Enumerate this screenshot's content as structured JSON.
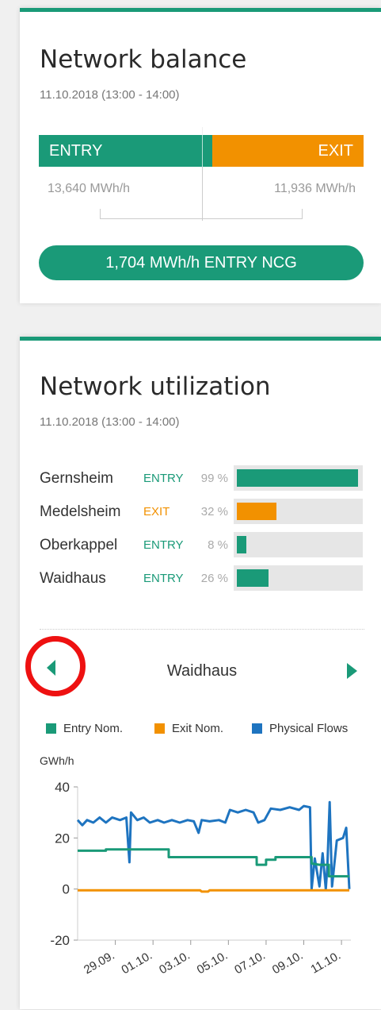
{
  "balance": {
    "title": "Network balance",
    "date": "11.10.2018 (13:00 - 14:00)",
    "entry_label": "ENTRY",
    "exit_label": "EXIT",
    "entry_value": "13,640 MWh/h",
    "exit_value": "11,936 MWh/h",
    "net_label": "1,704 MWh/h ENTRY NCG",
    "colors": {
      "entry": "#1a9a78",
      "exit": "#f29100"
    }
  },
  "utilization": {
    "title": "Network utilization",
    "date": "11.10.2018 (13:00 - 14:00)",
    "rows": [
      {
        "name": "Gernsheim",
        "direction": "ENTRY",
        "percent": "99 %",
        "value": 99
      },
      {
        "name": "Medelsheim",
        "direction": "EXIT",
        "percent": "32 %",
        "value": 32
      },
      {
        "name": "Oberkappel",
        "direction": "ENTRY",
        "percent": "8 %",
        "value": 8
      },
      {
        "name": "Waidhaus",
        "direction": "ENTRY",
        "percent": "26 %",
        "value": 26
      }
    ],
    "nav": {
      "title": "Waidhaus",
      "prev_icon": "triangle-left-icon",
      "next_icon": "triangle-right-icon"
    }
  },
  "legend": {
    "entry": "Entry Nom.",
    "exit": "Exit Nom.",
    "physical": "Physical Flows"
  },
  "chart_data": {
    "type": "line",
    "ylabel": "GWh/h",
    "ylim": [
      -20,
      40
    ],
    "yticks": [
      -20,
      0,
      20,
      40
    ],
    "x_range": [
      "2018-09-27",
      "2018-10-11"
    ],
    "xtick_labels": [
      "29.09.",
      "01.10.",
      "03.10.",
      "05.10.",
      "07.10.",
      "09.10.",
      "11.10."
    ],
    "xtick_dates": [
      "2018-09-29",
      "2018-10-01",
      "2018-10-03",
      "2018-10-05",
      "2018-10-07",
      "2018-10-09",
      "2018-10-11"
    ],
    "series": [
      {
        "name": "Physical Flows",
        "color": "#1e74c0",
        "points": [
          [
            "2018-09-27T00:00",
            27
          ],
          [
            "2018-09-27T06:00",
            25
          ],
          [
            "2018-09-27T12:00",
            27
          ],
          [
            "2018-09-27T20:00",
            26
          ],
          [
            "2018-09-28T04:00",
            28
          ],
          [
            "2018-09-28T12:00",
            26
          ],
          [
            "2018-09-28T20:00",
            28
          ],
          [
            "2018-09-29T06:00",
            27
          ],
          [
            "2018-09-29T14:00",
            28
          ],
          [
            "2018-09-29T18:00",
            10.5
          ],
          [
            "2018-09-29T20:00",
            30
          ],
          [
            "2018-09-30T04:00",
            27
          ],
          [
            "2018-09-30T12:00",
            28
          ],
          [
            "2018-09-30T20:00",
            26
          ],
          [
            "2018-10-01T06:00",
            27
          ],
          [
            "2018-10-01T14:00",
            26
          ],
          [
            "2018-10-02T00:00",
            27
          ],
          [
            "2018-10-02T10:00",
            26
          ],
          [
            "2018-10-02T20:00",
            27
          ],
          [
            "2018-10-03T04:00",
            26.5
          ],
          [
            "2018-10-03T10:00",
            22
          ],
          [
            "2018-10-03T14:00",
            27
          ],
          [
            "2018-10-04T00:00",
            26.5
          ],
          [
            "2018-10-04T12:00",
            27
          ],
          [
            "2018-10-04T20:00",
            26
          ],
          [
            "2018-10-05T02:00",
            31
          ],
          [
            "2018-10-05T12:00",
            30
          ],
          [
            "2018-10-05T22:00",
            31
          ],
          [
            "2018-10-06T08:00",
            30
          ],
          [
            "2018-10-06T14:00",
            26
          ],
          [
            "2018-10-06T22:00",
            27
          ],
          [
            "2018-10-07T06:00",
            31.5
          ],
          [
            "2018-10-07T18:00",
            31
          ],
          [
            "2018-10-08T06:00",
            32
          ],
          [
            "2018-10-08T18:00",
            31
          ],
          [
            "2018-10-09T00:00",
            32.5
          ],
          [
            "2018-10-09T08:00",
            32
          ],
          [
            "2018-10-09T10:00",
            0
          ],
          [
            "2018-10-09T14:00",
            12
          ],
          [
            "2018-10-09T20:00",
            1
          ],
          [
            "2018-10-10T00:00",
            14
          ],
          [
            "2018-10-10T04:00",
            0
          ],
          [
            "2018-10-10T06:00",
            9
          ],
          [
            "2018-10-10T09:00",
            34
          ],
          [
            "2018-10-10T12:00",
            1
          ],
          [
            "2018-10-10T18:00",
            19
          ],
          [
            "2018-10-11T02:00",
            20
          ],
          [
            "2018-10-11T06:00",
            24
          ],
          [
            "2018-10-11T10:00",
            0
          ]
        ]
      },
      {
        "name": "Entry Nom.",
        "color": "#1a9a78",
        "points": [
          [
            "2018-09-27T00:00",
            15
          ],
          [
            "2018-09-28T12:00",
            15
          ],
          [
            "2018-09-28T12:01",
            15.5
          ],
          [
            "2018-10-01T20:00",
            15.5
          ],
          [
            "2018-10-01T20:01",
            12.5
          ],
          [
            "2018-10-06T12:00",
            12.5
          ],
          [
            "2018-10-06T12:01",
            9.5
          ],
          [
            "2018-10-07T00:00",
            9.5
          ],
          [
            "2018-10-07T00:01",
            11.5
          ],
          [
            "2018-10-07T12:00",
            11.5
          ],
          [
            "2018-10-07T12:01",
            12.5
          ],
          [
            "2018-10-09T10:00",
            12.5
          ],
          [
            "2018-10-09T10:01",
            10
          ],
          [
            "2018-10-09T20:00",
            9.5
          ],
          [
            "2018-10-10T08:00",
            9.5
          ],
          [
            "2018-10-10T08:01",
            5
          ],
          [
            "2018-10-11T10:00",
            5
          ]
        ]
      },
      {
        "name": "Exit Nom.",
        "color": "#f29100",
        "points": [
          [
            "2018-09-27T00:00",
            -0.5
          ],
          [
            "2018-10-03T12:00",
            -0.5
          ],
          [
            "2018-10-03T14:00",
            -1
          ],
          [
            "2018-10-03T22:00",
            -1
          ],
          [
            "2018-10-04T00:00",
            -0.5
          ],
          [
            "2018-10-11T10:00",
            -0.5
          ]
        ]
      }
    ]
  }
}
